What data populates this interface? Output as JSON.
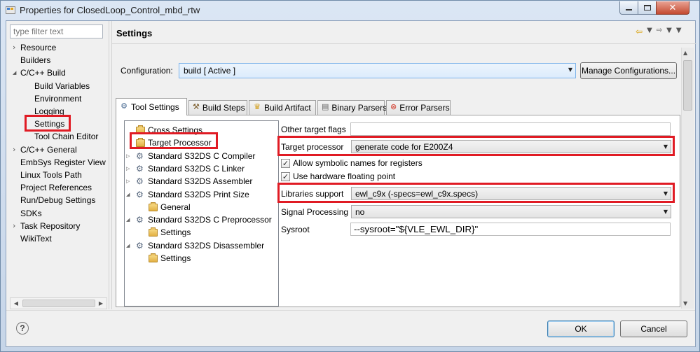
{
  "window": {
    "title": "Properties for ClosedLoop_Control_mbd_rtw",
    "minimize_glyph": "–",
    "close_glyph": "✕"
  },
  "nav": {
    "filter_placeholder": "type filter text",
    "items": [
      {
        "label": "Resource",
        "arrow": "collapsed"
      },
      {
        "label": "Builders",
        "arrow": ""
      },
      {
        "label": "C/C++ Build",
        "arrow": "expanded"
      },
      {
        "label": "Build Variables",
        "arrow": ""
      },
      {
        "label": "Environment",
        "arrow": ""
      },
      {
        "label": "Logging",
        "arrow": ""
      },
      {
        "label": "Settings",
        "arrow": "",
        "selected": true
      },
      {
        "label": "Tool Chain Editor",
        "arrow": ""
      },
      {
        "label": "C/C++ General",
        "arrow": "collapsed"
      },
      {
        "label": "EmbSys Register View",
        "arrow": ""
      },
      {
        "label": "Linux Tools Path",
        "arrow": ""
      },
      {
        "label": "Project References",
        "arrow": ""
      },
      {
        "label": "Run/Debug Settings",
        "arrow": ""
      },
      {
        "label": "SDKs",
        "arrow": ""
      },
      {
        "label": "Task Repository",
        "arrow": "collapsed"
      },
      {
        "label": "WikiText",
        "arrow": ""
      }
    ]
  },
  "page": {
    "title": "Settings",
    "configuration_label": "Configuration:",
    "configuration_value": "build  [ Active ]",
    "manage_button": "Manage Configurations..."
  },
  "tabs": [
    {
      "label": "Tool Settings",
      "icon": "tool-settings-icon",
      "active": true
    },
    {
      "label": "Build Steps",
      "icon": "build-steps-icon"
    },
    {
      "label": "Build Artifact",
      "icon": "build-artifact-icon"
    },
    {
      "label": "Binary Parsers",
      "icon": "binary-parsers-icon"
    },
    {
      "label": "Error Parsers",
      "icon": "error-parsers-icon"
    }
  ],
  "tool_tree": [
    {
      "label": "Cross Settings",
      "icon": "folder"
    },
    {
      "label": "Target Processor",
      "icon": "folder",
      "selected": true
    },
    {
      "label": "Standard S32DS C Compiler",
      "icon": "gear",
      "arrow": "collapsed"
    },
    {
      "label": "Standard S32DS C Linker",
      "icon": "gear",
      "arrow": "collapsed"
    },
    {
      "label": "Standard S32DS Assembler",
      "icon": "gear",
      "arrow": "collapsed"
    },
    {
      "label": "Standard S32DS Print Size",
      "icon": "gear",
      "arrow": "expanded"
    },
    {
      "label": "General",
      "icon": "folder"
    },
    {
      "label": "Standard S32DS C Preprocessor",
      "icon": "gear",
      "arrow": "expanded"
    },
    {
      "label": "Settings",
      "icon": "folder"
    },
    {
      "label": "Standard S32DS Disassembler",
      "icon": "gear",
      "arrow": "expanded"
    },
    {
      "label": "Settings",
      "icon": "folder"
    }
  ],
  "options": {
    "other_target_flags_label": "Other target flags",
    "other_target_flags_value": "",
    "target_processor_label": "Target processor",
    "target_processor_value": "generate code for E200Z4",
    "allow_symbolic_label": "Allow symbolic names for registers",
    "allow_symbolic_checked": true,
    "hw_float_label": "Use hardware floating point",
    "hw_float_checked": true,
    "libraries_support_label": "Libraries support",
    "libraries_support_value": "ewl_c9x (-specs=ewl_c9x.specs)",
    "signal_processing_label": "Signal Processing",
    "signal_processing_value": "no",
    "sysroot_label": "Sysroot",
    "sysroot_value": "--sysroot=\"${VLE_EWL_DIR}\""
  },
  "footer": {
    "help": "?",
    "ok": "OK",
    "cancel": "Cancel"
  },
  "colors": {
    "highlight_box": "#e01b24",
    "combo_focus": "#7eb4ea"
  }
}
